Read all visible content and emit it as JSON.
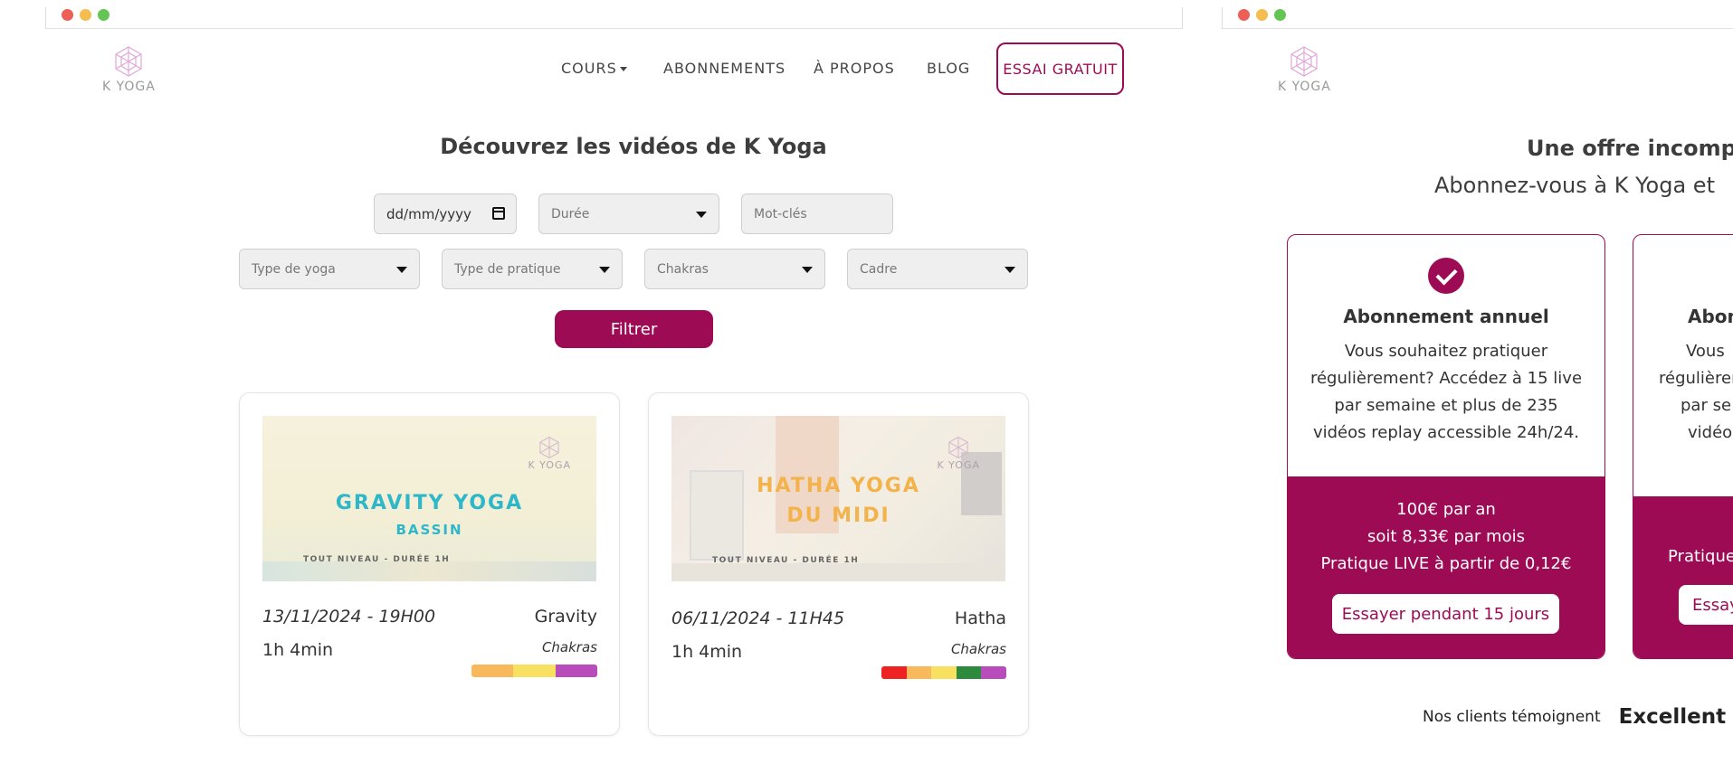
{
  "colors": {
    "brand": "#9e0b55",
    "text": "#333333",
    "field_bg": "#efefef"
  },
  "logo": {
    "text": "K YOGA",
    "icon": "lotus-icon"
  },
  "nav": {
    "items": [
      {
        "label": "COURS",
        "has_dropdown": true
      },
      {
        "label": "ABONNEMENTS"
      },
      {
        "label": "À PROPOS"
      },
      {
        "label": "BLOG"
      }
    ],
    "cta": "ESSAI GRATUIT"
  },
  "videos_page": {
    "title": "Découvrez les vidéos de K Yoga",
    "filters": {
      "date_placeholder": "dd/mm/yyyy",
      "duration": "Durée",
      "keywords_placeholder": "Mot-clés",
      "yoga_type": "Type de yoga",
      "practice_type": "Type de pratique",
      "chakras": "Chakras",
      "setting": "Cadre",
      "submit": "Filtrer"
    },
    "cards": [
      {
        "thumb_title": "GRAVITY YOGA",
        "thumb_subtitle": "BASSIN",
        "thumb_caption": "TOUT NIVEAU - DURÉE 1H",
        "thumb_logo": "K YOGA",
        "date": "13/11/2024 - 19H00",
        "type": "Gravity",
        "duration": "1h 4min",
        "chakras_label": "Chakras",
        "chakras": [
          "#f8b85c",
          "#f8e060",
          "#b84cba"
        ]
      },
      {
        "thumb_title": "HATHA YOGA",
        "thumb_subtitle": "DU MIDI",
        "thumb_caption": "TOUT NIVEAU - DURÉE 1H",
        "thumb_logo": "K YOGA",
        "date": "06/11/2024 - 11H45",
        "type": "Hatha",
        "duration": "1h 4min",
        "chakras_label": "Chakras",
        "chakras": [
          "#ee2222",
          "#f8b85c",
          "#f8e060",
          "#2d8a3c",
          "#b84cba"
        ]
      }
    ]
  },
  "offers_page": {
    "title": "Une offre incompa",
    "subtitle": "Abonnez-vous à K Yoga et",
    "cards": [
      {
        "name": "Abonnement annuel",
        "description": "Vous souhaitez pratiquer régulièrement? Accédez à 15 live par semaine et plus de 235 vidéos replay accessible 24h/24.",
        "price_lines": [
          "100€ par an",
          "soit 8,33€ par mois",
          "Pratique LIVE à partir de 0,12€"
        ],
        "button": "Essayer pendant 15 jours"
      },
      {
        "name": "Abon",
        "description_lines": [
          "Vous",
          "régulièrem",
          "par se",
          "vidéos"
        ],
        "price_lines": [
          "Pratique"
        ],
        "button": "Essay"
      }
    ],
    "testimony": {
      "label": "Nos clients témoignent",
      "rating": "Excellent"
    }
  }
}
